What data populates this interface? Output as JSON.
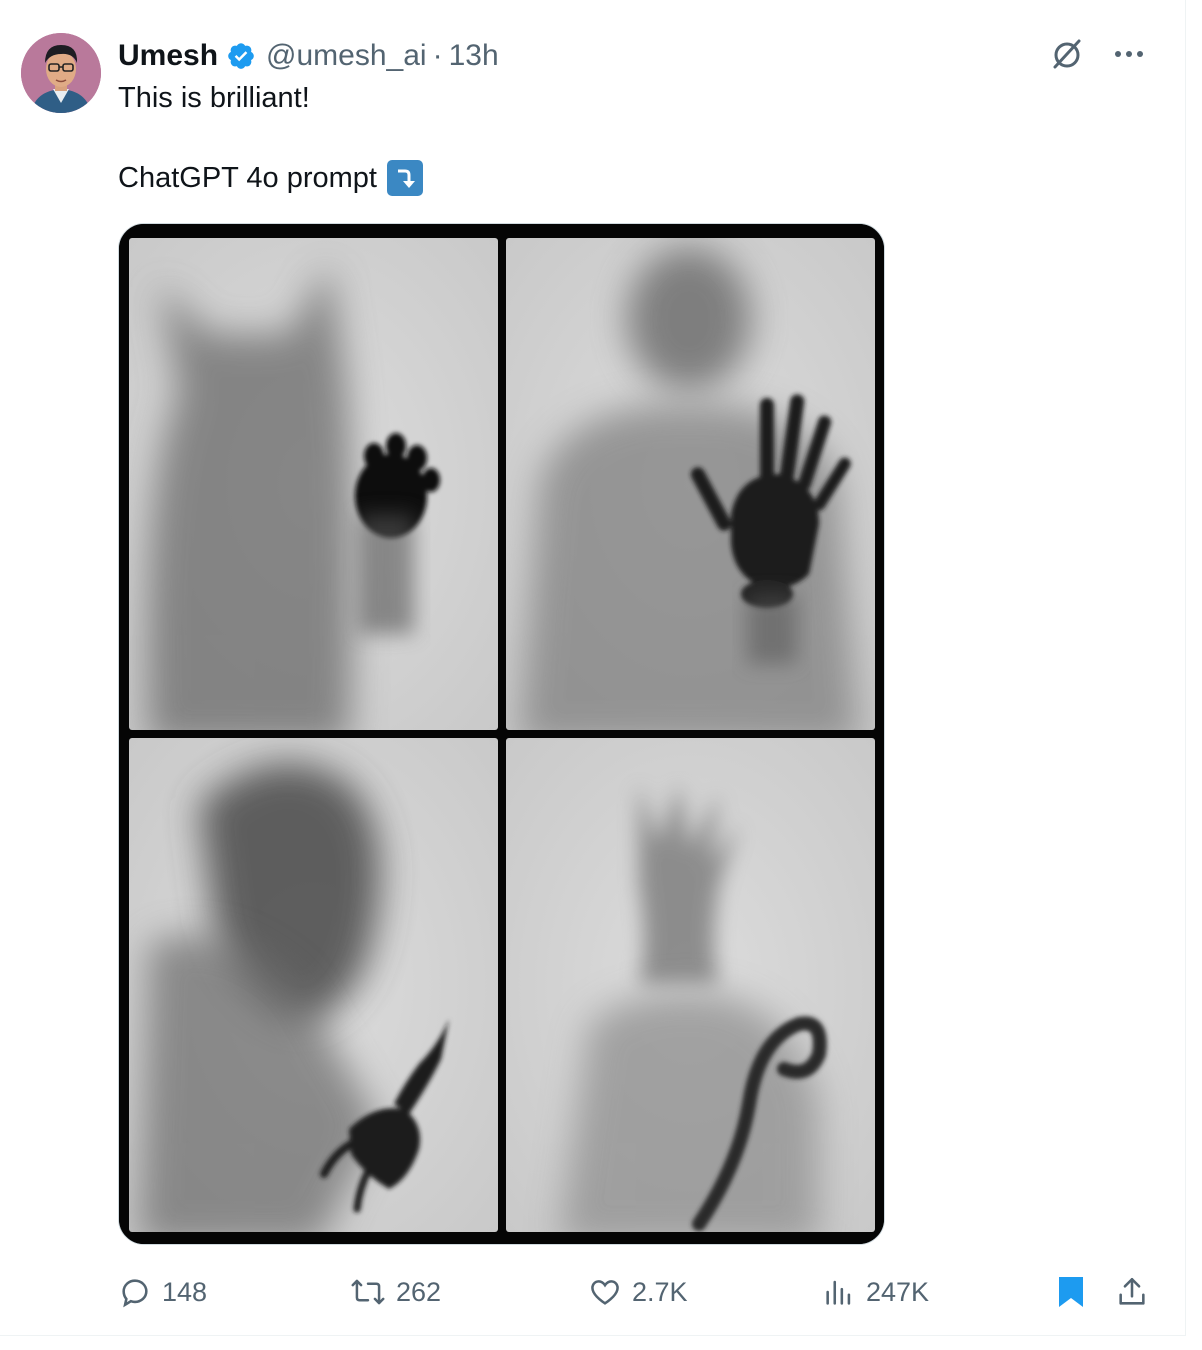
{
  "tweet": {
    "author_name": "Umesh",
    "handle": "@umesh_ai",
    "separator": "·",
    "time": "13h",
    "text_line1": "This is brilliant!",
    "text_line2": "ChatGPT 4o prompt",
    "emoji": "arrow-curving-down-emoji"
  },
  "actions": {
    "replies": "148",
    "reposts": "262",
    "likes": "2.7K",
    "views": "247K"
  },
  "colors": {
    "verified": "#1d9bf0",
    "bookmark_active": "#1d9bf0",
    "muted_text": "#536471",
    "emoji_bg": "#3b88c3"
  },
  "media": {
    "panels": [
      "cat-paw-silhouette",
      "robot-hand-silhouette",
      "alien-claw-silhouette",
      "creature-tail-silhouette"
    ]
  }
}
